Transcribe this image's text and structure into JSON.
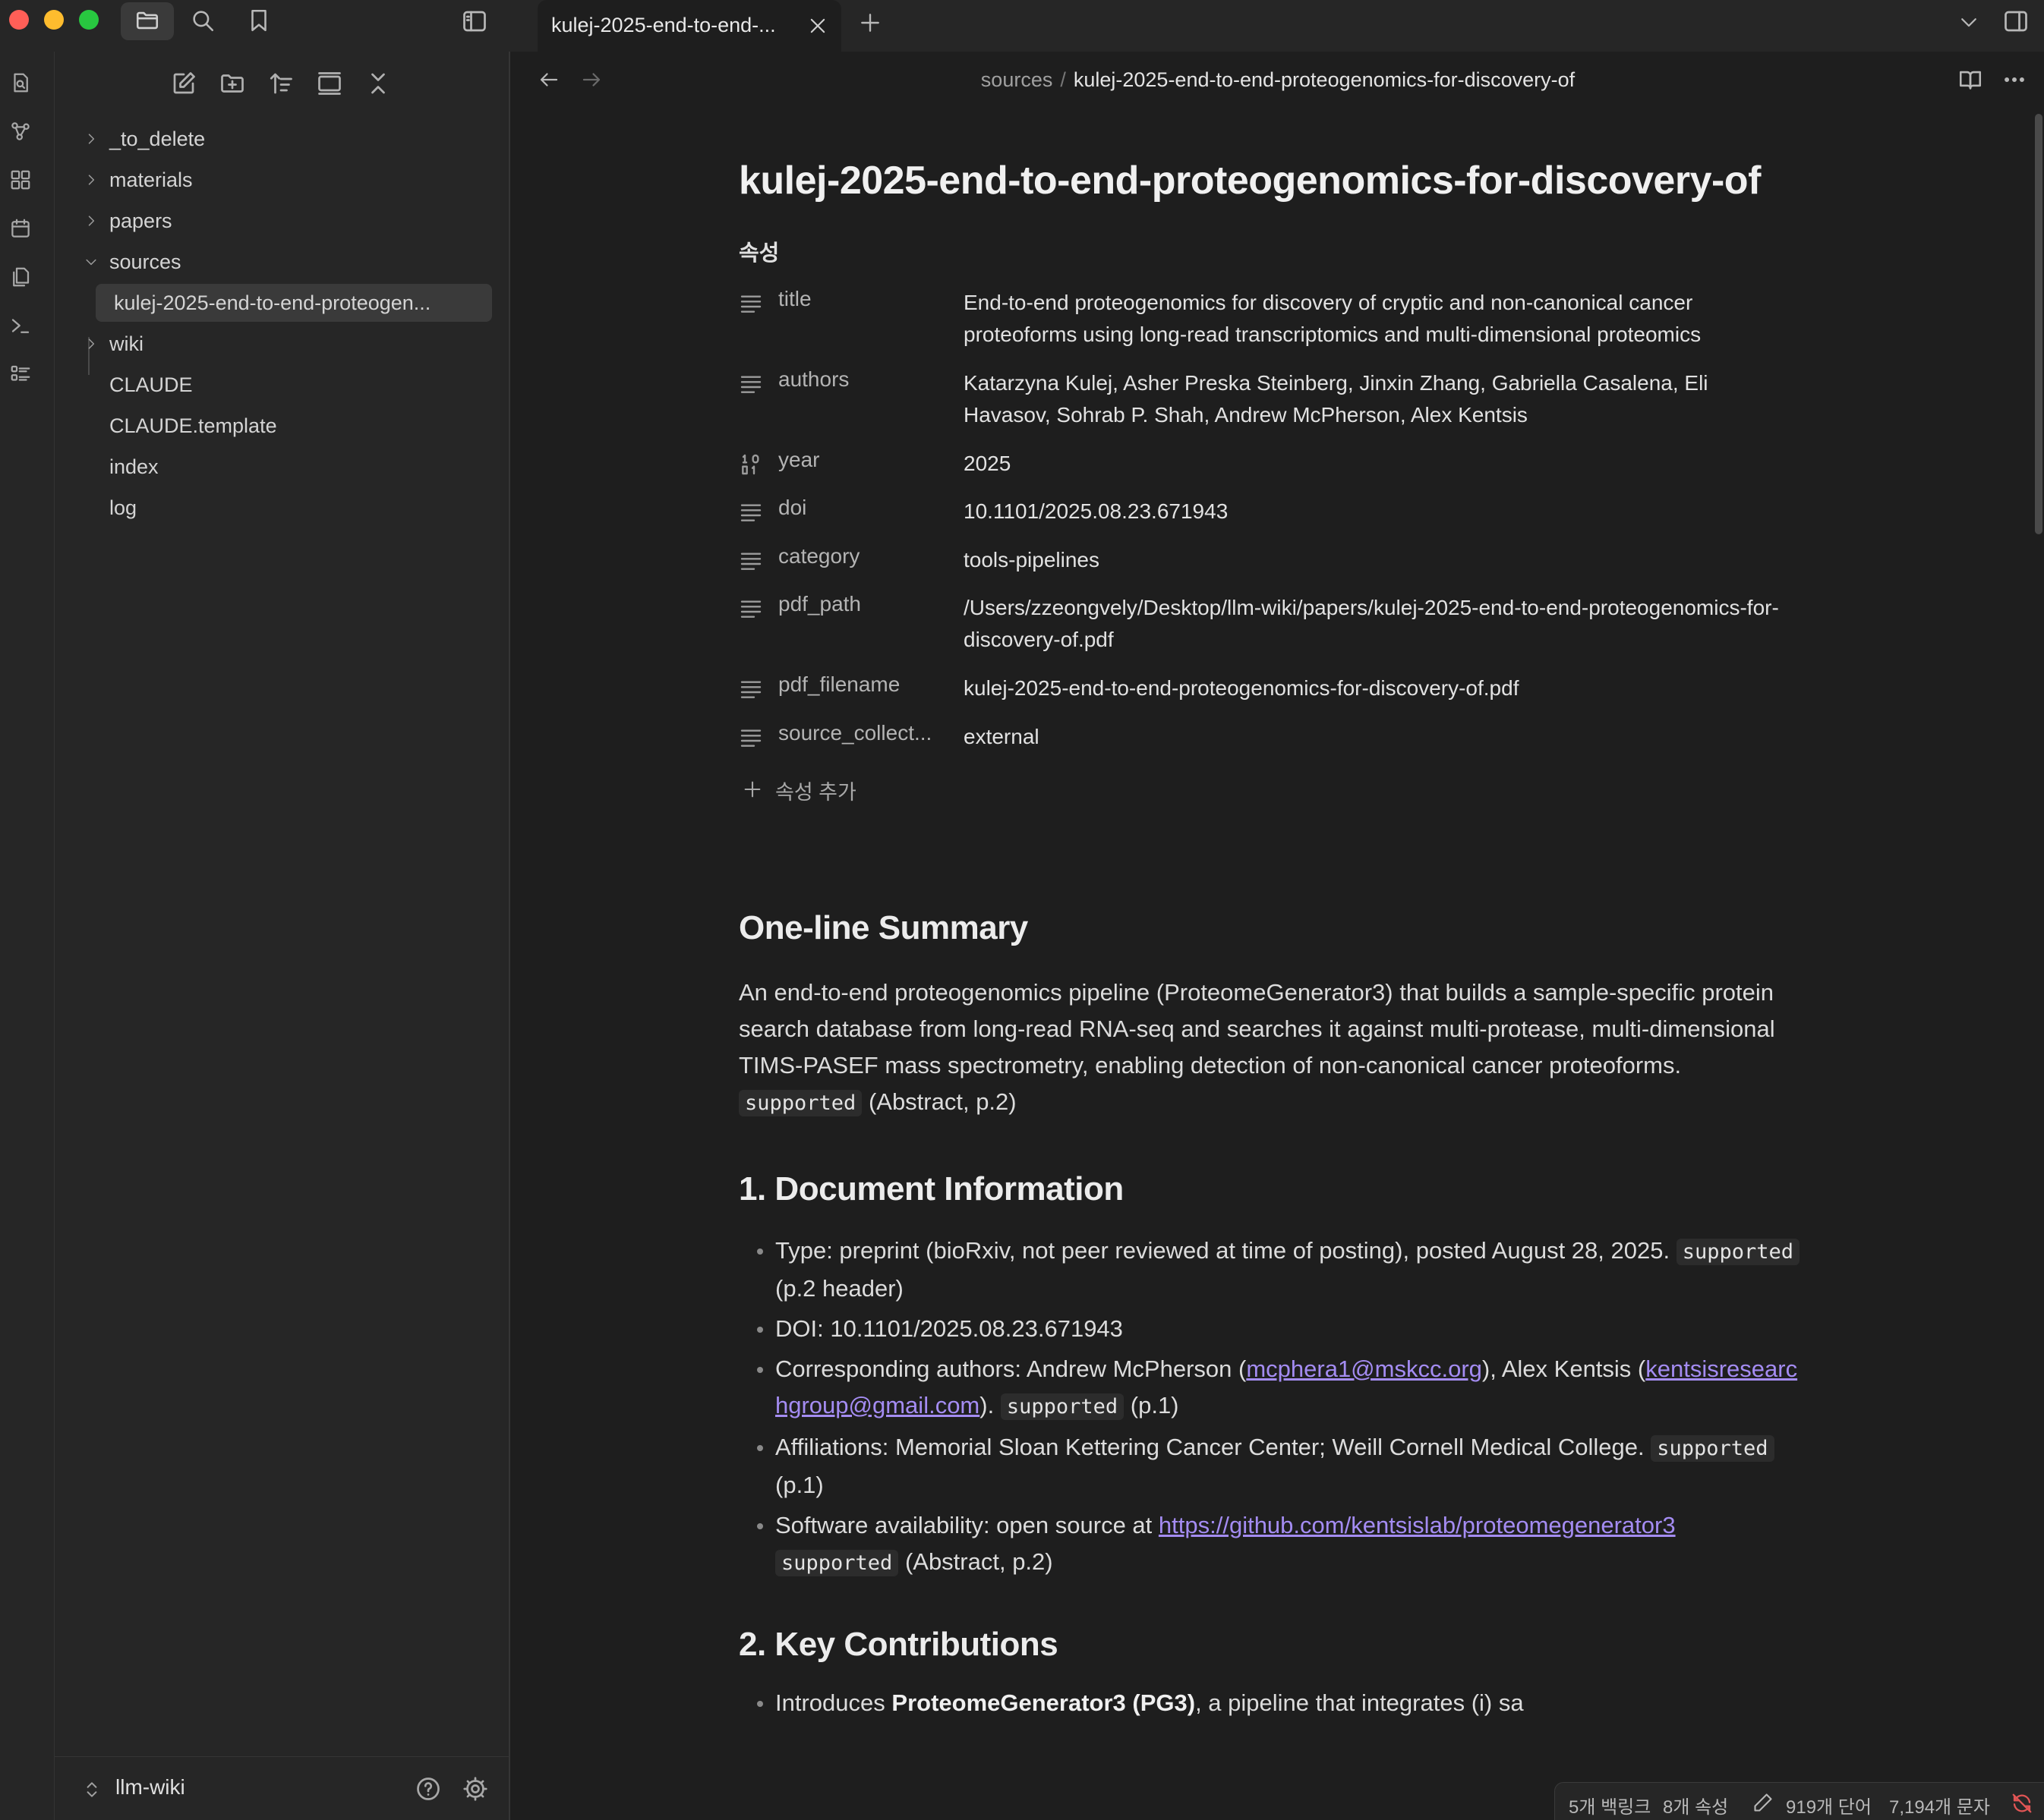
{
  "titlebar": {
    "tab_title": "kulej-2025-end-to-end-...",
    "colors": {
      "close": "#ff5f57",
      "minimize": "#febc2e",
      "zoom": "#28c840"
    }
  },
  "sidebar": {
    "tree": [
      {
        "label": "_to_delete",
        "type": "folder",
        "expanded": false
      },
      {
        "label": "materials",
        "type": "folder",
        "expanded": false
      },
      {
        "label": "papers",
        "type": "folder",
        "expanded": false
      },
      {
        "label": "sources",
        "type": "folder",
        "expanded": true
      },
      {
        "label": "kulej-2025-end-to-end-proteogen...",
        "type": "file",
        "active": true
      },
      {
        "label": "wiki",
        "type": "folder",
        "expanded": false
      },
      {
        "label": "CLAUDE",
        "type": "file"
      },
      {
        "label": "CLAUDE.template",
        "type": "file"
      },
      {
        "label": "index",
        "type": "file"
      },
      {
        "label": "log",
        "type": "file"
      }
    ],
    "vault_name": "llm-wiki"
  },
  "breadcrumb": {
    "folder": "sources",
    "separator": "/",
    "file": "kulej-2025-end-to-end-proteogenomics-for-discovery-of"
  },
  "note": {
    "title": "kulej-2025-end-to-end-proteogenomics-for-discovery-of",
    "properties_heading": "속성",
    "properties": [
      {
        "icon": "text-lines-icon",
        "key": "title",
        "value": "End-to-end proteogenomics for discovery of cryptic and non-canonical cancer proteoforms using long-read transcriptomics and multi-dimensional proteomics"
      },
      {
        "icon": "text-lines-icon",
        "key": "authors",
        "value": "Katarzyna Kulej, Asher Preska Steinberg, Jinxin Zhang, Gabriella Casalena, Eli Havasov, Sohrab P. Shah, Andrew McPherson, Alex Kentsis"
      },
      {
        "icon": "number-icon",
        "key": "year",
        "value": "2025"
      },
      {
        "icon": "text-lines-icon",
        "key": "doi",
        "value": "10.1101/2025.08.23.671943"
      },
      {
        "icon": "text-lines-icon",
        "key": "category",
        "value": "tools-pipelines"
      },
      {
        "icon": "text-lines-icon",
        "key": "pdf_path",
        "value": "/Users/zzeongvely/Desktop/llm-wiki/papers/kulej-2025-end-to-end-proteogenomics-for-discovery-of.pdf"
      },
      {
        "icon": "text-lines-icon",
        "key": "pdf_filename",
        "value": "kulej-2025-end-to-end-proteogenomics-for-discovery-of.pdf"
      },
      {
        "icon": "text-lines-icon",
        "key": "source_collect...",
        "value": "external"
      }
    ],
    "add_property_label": "속성 추가",
    "summary": {
      "heading": "One-line Summary",
      "text": "An end-to-end proteogenomics pipeline (ProteomeGenerator3) that builds a sample-specific protein search database from long-read RNA-seq and searches it against multi-protease, multi-dimensional TIMS-PASEF mass spectrometry, enabling detection of non-canonical cancer proteoforms.",
      "tag": "supported",
      "cite": "(Abstract, p.2)"
    },
    "doc_info": {
      "heading": "1. Document Information",
      "type_text": "Type: preprint (bioRxiv, not peer reviewed at time of posting), posted August 28, 2025.",
      "type_tag": "supported",
      "type_cite": "(p.2 header)",
      "doi_text": "DOI: 10.1101/2025.08.23.671943",
      "corr_prefix": "Corresponding authors: Andrew McPherson (",
      "corr_email1": "mcphera1@mskcc.org",
      "corr_mid": "), Alex Kentsis (",
      "corr_email2": "kentsisresearchgroup@gmail.com",
      "corr_suffix": ").",
      "corr_tag": "supported",
      "corr_cite": "(p.1)",
      "aff_text": "Affiliations: Memorial Sloan Kettering Cancer Center; Weill Cornell Medical College.",
      "aff_tag": "supported",
      "aff_cite": "(p.1)",
      "sw_prefix": "Software availability: open source at",
      "sw_link": "https://github.com/kentsislab/proteomegenerator3",
      "sw_tag": "supported",
      "sw_cite": "(Abstract, p.2)"
    },
    "contributions": {
      "heading": "2. Key Contributions",
      "first_prefix": "Introduces",
      "first_bold": "ProteomeGenerator3 (PG3)",
      "first_rest": ", a pipeline that integrates (i) sa"
    }
  },
  "statusbar": {
    "backlinks": "5개 백링크",
    "properties": "8개 속성",
    "words": "919개 단어",
    "chars": "7,194개 문자"
  },
  "colors": {
    "link": "#a48cf2",
    "background": "#1e1e1e",
    "sidebar": "#262626"
  }
}
